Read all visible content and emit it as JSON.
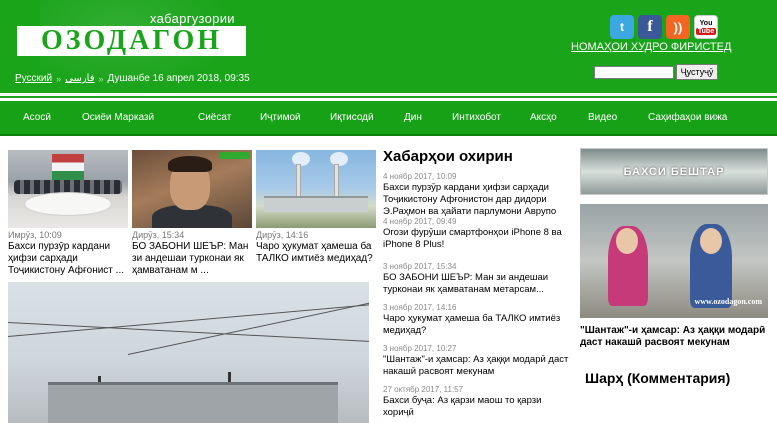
{
  "header": {
    "tagline": "хабаргузории",
    "logo_text": "ОЗОДАГОН",
    "languages": [
      "Русский",
      "فارسی"
    ],
    "datetime": "Душанбе 16 апрел 2018, 09:35",
    "register_link": "НОМАҲОИ ХУДРО ФИРИСТЕД",
    "search_button": "Ҷустуҷӯ",
    "search_value": "",
    "social": [
      {
        "name": "twitter-icon",
        "glyph": "t",
        "color": "#3ba9e0"
      },
      {
        "name": "facebook-icon",
        "glyph": "f",
        "color": "#3b5998"
      },
      {
        "name": "rss-icon",
        "glyph": "☰",
        "color": "#f26522"
      },
      {
        "name": "youtube-icon",
        "glyph": "You Tube",
        "color": "#d21c1c"
      }
    ]
  },
  "nav": [
    "Асосӣ",
    "Осиёи Марказӣ",
    "Сиёсат",
    "Иҷтимоӣ",
    "Иқтисодӣ",
    "Дин",
    "Интихобот",
    "Аксҳо",
    "Видео",
    "Саҳифаҳои вижа"
  ],
  "photo_tiles": [
    {
      "date": "Имрӯз, 10:09",
      "text": "Бахси пурзӯр кардани ҳифзи сарҳади Тоҷикистону Афғонист ..."
    },
    {
      "date": "Дирӯз, 15:34",
      "text": "БО ЗАБОНИ ШЕЪР: Ман зи андешаи турконаи як ҳамватанам м ..."
    },
    {
      "date": "Дирӯз, 14:16",
      "text": "Чаро ҳукумат ҳамеша ба ТАЛКО имтиёз медиҳад?"
    }
  ],
  "latest_news": {
    "title": "Хабарҳои охирин",
    "items": [
      {
        "date": "4 ноябр 2017, 10:09",
        "text": "Бахси пурзӯр кардани ҳифзи сарҳади Тоҷикистону Афғонистон дар дидори Э.Раҳмон ва ҳайати парлумони Аврупо"
      },
      {
        "date": "4 ноябр 2017, 09:49",
        "text": "Огози фурӯши смартфонҳои iPhone 8 ва iPhone 8 Plus!"
      },
      {
        "date": "3 ноябр 2017, 15:34",
        "text": "БО ЗАБОНИ ШЕЪР: Ман зи андешаи турконаи як ҳамватанам метарсам..."
      },
      {
        "date": "3 ноябр 2017, 14:16",
        "text": "Чаро ҳукумат ҳамеша ба ТАЛКО имтиёз медиҳад?"
      },
      {
        "date": "3 ноябр 2017, 10:27",
        "text": "\"Шантаж\"-и ҳамсар: Аз ҳаққи модарӣ даст накашӣ расвоят мекунам"
      },
      {
        "date": "27 октябр 2017, 11:57",
        "text": "Бахси буҷа: Аз қарзи маош то қарзи хориҷӣ"
      }
    ]
  },
  "right": {
    "banner": "БАХСИ БЕШТАР",
    "video_watermark": "www.ozodagon.com",
    "video_caption": "\"Шантаж\"-и ҳамсар: Аз ҳаққи модарӣ даст накашӣ расвоят мекунам",
    "comments_title": "Шарҳ (Комментария)"
  }
}
